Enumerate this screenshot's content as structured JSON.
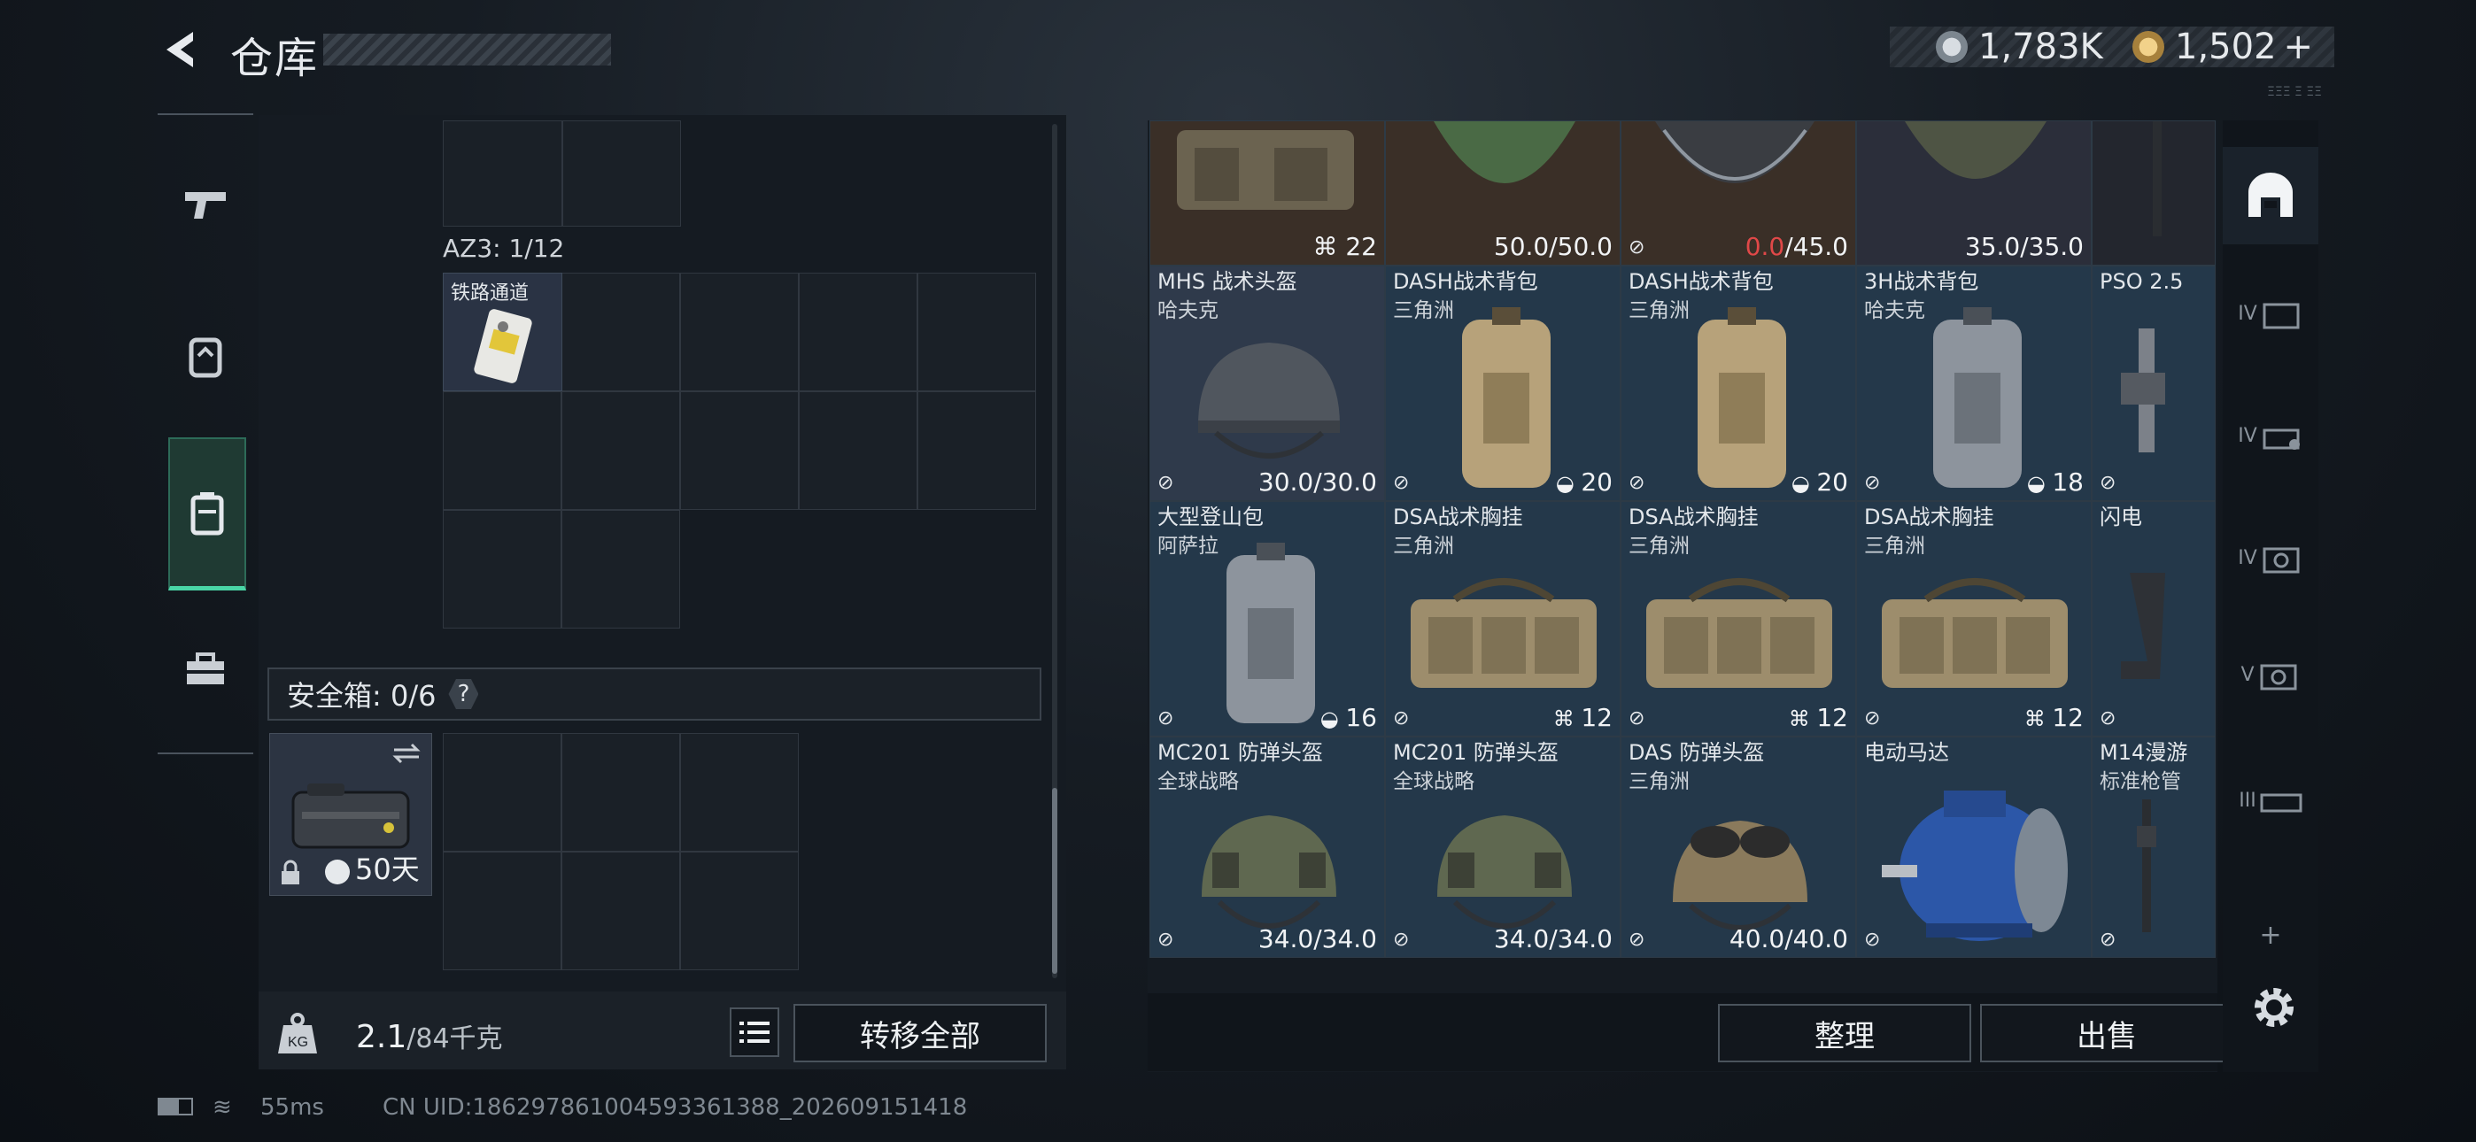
{
  "header": {
    "title": "仓库",
    "currency_silver": "1,783K",
    "currency_gold": "1,502",
    "gold_plus": "+"
  },
  "nav": {
    "icons": [
      "pistol-icon",
      "armor-icon",
      "backpack-icon",
      "toolbox-icon"
    ]
  },
  "left": {
    "az3_label": "AZ3: 1/12",
    "rail_item": "铁路通道",
    "safe_label": "安全箱: 0/6",
    "safe_help": "?",
    "safe_days": "50天",
    "weight_value": "2.1",
    "weight_max": "/84千克",
    "transfer_all": "转移全部"
  },
  "right": {
    "top_row": [
      {
        "val": "22",
        "icon": "vest-icon"
      },
      {
        "val": "50.0/50.0",
        "icon": ""
      },
      {
        "val_red": "0.0",
        "val": "/45.0",
        "icon": "no-sell-icon"
      },
      {
        "val": "35.0/35.0",
        "icon": ""
      },
      {
        "val": "",
        "icon": ""
      }
    ],
    "rows": [
      [
        {
          "name": "MHS 战术头盔",
          "sub": "哈夫克",
          "val": "30.0/30.0",
          "kind": "helmet"
        },
        {
          "name": "DASH战术背包",
          "sub": "三角洲",
          "val": "20",
          "kind": "bag-tan",
          "val_icon": "bag-capacity-icon"
        },
        {
          "name": "DASH战术背包",
          "sub": "三角洲",
          "val": "20",
          "kind": "bag-tan",
          "val_icon": "bag-capacity-icon"
        },
        {
          "name": "3H战术背包",
          "sub": "哈夫克",
          "val": "18",
          "kind": "bag-grey",
          "val_icon": "bag-capacity-icon"
        },
        {
          "name": "PSO 2.5",
          "sub": "",
          "val": "",
          "kind": "scope"
        }
      ],
      [
        {
          "name": "大型登山包",
          "sub": "阿萨拉",
          "val": "16",
          "kind": "bag-grey",
          "val_icon": "bag-capacity-icon"
        },
        {
          "name": "DSA战术胸挂",
          "sub": "三角洲",
          "val": "12",
          "kind": "rig",
          "val_icon": "vest-icon"
        },
        {
          "name": "DSA战术胸挂",
          "sub": "三角洲",
          "val": "12",
          "kind": "rig",
          "val_icon": "vest-icon"
        },
        {
          "name": "DSA战术胸挂",
          "sub": "三角洲",
          "val": "12",
          "kind": "rig",
          "val_icon": "vest-icon"
        },
        {
          "name": "闪电",
          "sub": "",
          "val": "",
          "kind": "grip"
        }
      ],
      [
        {
          "name": "MC201 防弹头盔",
          "sub": "全球战略",
          "val": "34.0/34.0",
          "kind": "helmet-olive"
        },
        {
          "name": "MC201 防弹头盔",
          "sub": "全球战略",
          "val": "34.0/34.0",
          "kind": "helmet-olive"
        },
        {
          "name": "DAS 防弹头盔",
          "sub": "三角洲",
          "val": "40.0/40.0",
          "kind": "helmet-tan"
        },
        {
          "name": "电动马达",
          "sub": "",
          "val": "",
          "kind": "motor"
        },
        {
          "name": "M14漫游",
          "sub": "标准枪管",
          "val": "",
          "kind": "barrel"
        }
      ]
    ],
    "sort_button": "整理",
    "sell_button": "出售"
  },
  "rail": {
    "levels": [
      "IV",
      "IV",
      "IV",
      "V",
      "III"
    ]
  },
  "status": {
    "ping": "55ms",
    "uid": "CN UID:18629786100459336138​8_202609151418"
  }
}
